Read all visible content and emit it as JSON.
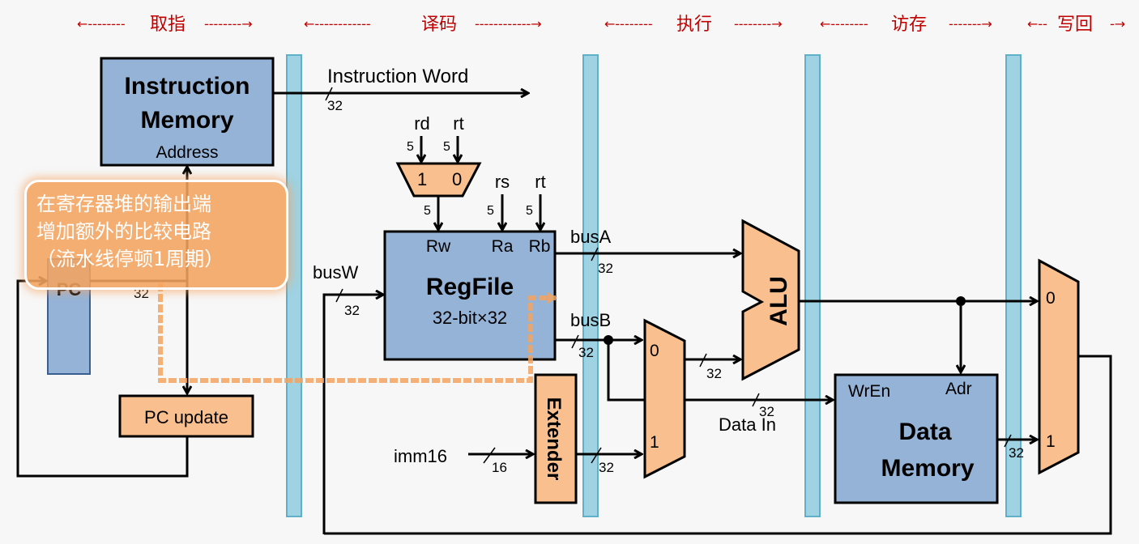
{
  "stages": [
    {
      "name": "取指"
    },
    {
      "name": "译码"
    },
    {
      "name": "执行"
    },
    {
      "name": "访存"
    },
    {
      "name": "写回"
    }
  ],
  "instruction_memory": {
    "title_line1": "Instruction",
    "title_line2": "Memory",
    "port": "Address"
  },
  "pc": {
    "label": "PC"
  },
  "pc_update": {
    "label": "PC update"
  },
  "instruction_word": {
    "label": "Instruction Word",
    "width": "32"
  },
  "regdst_mux": {
    "in1": "1",
    "in0": "0",
    "input_labels": [
      "rd",
      "rt"
    ],
    "widths": [
      "5",
      "5",
      "5"
    ]
  },
  "regfile": {
    "title": "RegFile",
    "subtitle": "32-bit×32",
    "ports": [
      "Rw",
      "Ra",
      "Rb"
    ],
    "read_inputs": [
      "rs",
      "rt"
    ],
    "read_widths": [
      "5",
      "5"
    ]
  },
  "buses": {
    "busA": "busA",
    "busB": "busB",
    "busW": "busW",
    "widthA": "32",
    "widthB": "32",
    "widthW": "32",
    "pc_width": "32"
  },
  "extender": {
    "label": "Extender",
    "input": "imm16",
    "in_width": "16",
    "out_width": "32"
  },
  "alusrc_mux": {
    "in0": "0",
    "in1": "1",
    "out_width": "32"
  },
  "alu": {
    "label": "ALU"
  },
  "data_in": {
    "label": "Data In",
    "width": "32"
  },
  "data_memory": {
    "title_line1": "Data",
    "title_line2": "Memory",
    "wren": "WrEn",
    "adr": "Adr",
    "out_width": "32"
  },
  "memtoreg_mux": {
    "in0": "0",
    "in1": "1"
  },
  "callout": {
    "lines": [
      "在寄存器堆的输出端",
      "增加额外的比较电路",
      "（流水线停顿1周期）"
    ]
  },
  "colors": {
    "stage_text": "#c00000",
    "pipeline_register": "#9fd2e2",
    "memory_block": "#95b3d7",
    "logic_block": "#fabf8f",
    "callout": "#f4a460"
  }
}
